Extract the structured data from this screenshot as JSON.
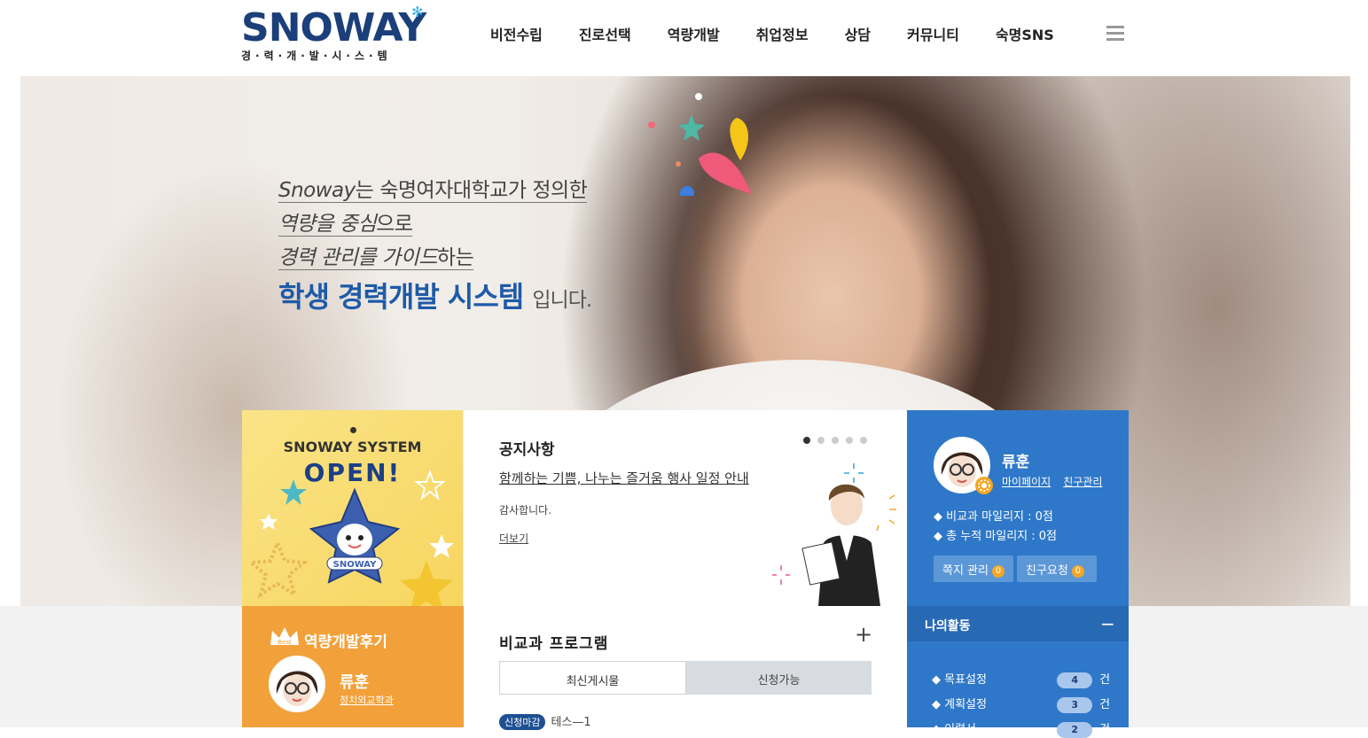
{
  "header": {
    "logo_text": "SNOWAY",
    "logo_sub": "경·력·개·발·시·스·템",
    "nav": [
      "비전수립",
      "진로선택",
      "역량개발",
      "취업정보",
      "상담",
      "커뮤니티",
      "숙명SNS"
    ]
  },
  "hero": {
    "line1_em": "Snoway",
    "line1_rest": "는 숙명여자대학교가 정의한",
    "line2_em": "역량을 중심",
    "line2_rest": "으로",
    "line3_em": "경력 관리를 가이드",
    "line3_rest": "하는",
    "line4_big": "학생 경력개발 시스템",
    "line4_tail": "입니다."
  },
  "open_card": {
    "title": "SNOWAY SYSTEM",
    "big": "OPEN!",
    "mascot_label": "SNOWAY"
  },
  "notice": {
    "title": "공지사항",
    "link": "함께하는 기쁨, 나누는 즐거움 행사 일정 안내",
    "body": "감사합니다.",
    "more": "더보기"
  },
  "profile": {
    "name": "류훈",
    "my_page": "마이페이지",
    "friends": "친구관리",
    "mileage1": "비교과 마일리지 : 0점",
    "mileage2": "총 누적 마일리지 : 0점",
    "msg_btn": "쪽지 관리",
    "msg_count": "0",
    "friend_btn": "친구요청",
    "friend_count": "0"
  },
  "review": {
    "title": "역량개발후기",
    "badge": "Best",
    "name": "류훈",
    "dept": "정치외교학과"
  },
  "program": {
    "title": "비교과 프로그램",
    "plus": "+",
    "tab_latest": "최신게시물",
    "tab_available": "신청가능",
    "row_badge": "신청마감",
    "row_text": "테스—1"
  },
  "activity": {
    "title": "나의활동",
    "minus": "−",
    "rows": [
      {
        "label": "목표설정",
        "count": "4",
        "unit": "건"
      },
      {
        "label": "계획설정",
        "count": "3",
        "unit": "건"
      },
      {
        "label": "이력서",
        "count": "2",
        "unit": "건"
      }
    ]
  },
  "colors": {
    "brand_blue": "#2f78c9",
    "orange": "#f2a13a",
    "yellow": "#f7d55f",
    "navy": "#1e4f93"
  }
}
